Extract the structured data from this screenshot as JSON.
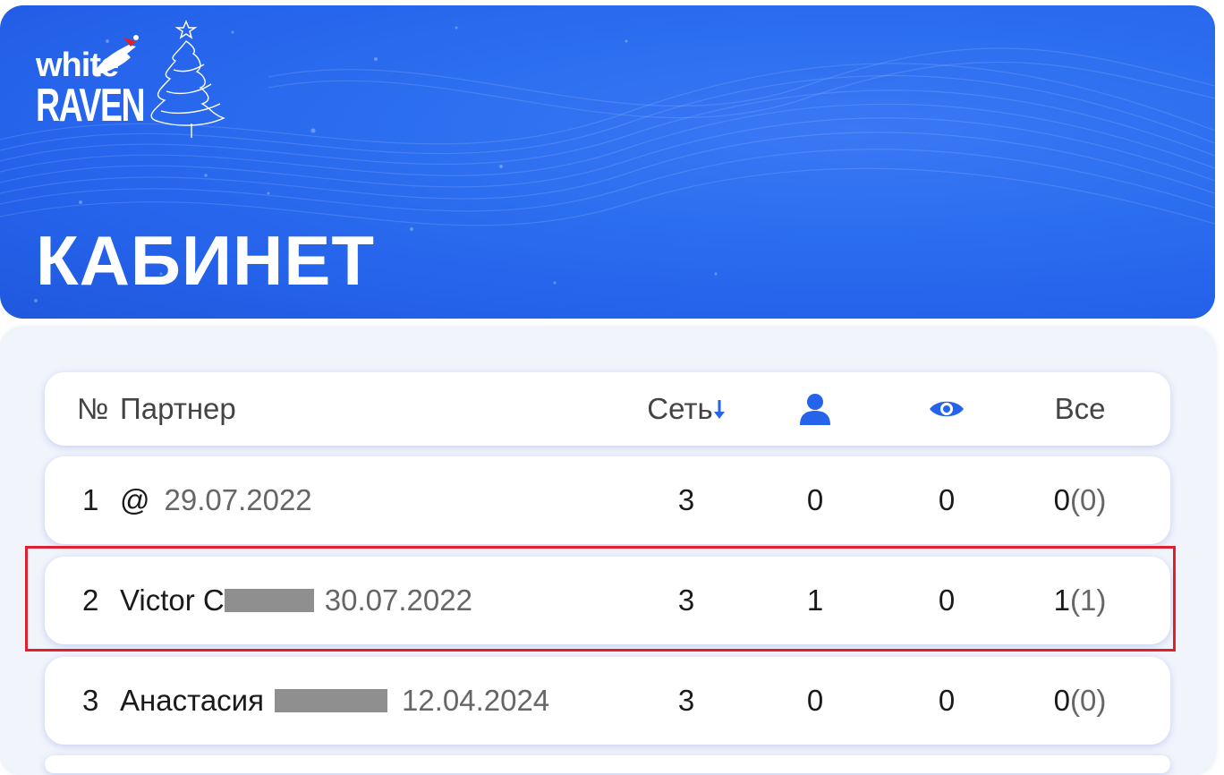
{
  "brand": {
    "line1": "white",
    "line2": "RAVEN"
  },
  "page": {
    "title": "КАБИНЕТ"
  },
  "table": {
    "headers": {
      "number": "№",
      "partner": "Партнер",
      "network": "Сеть",
      "all": "Все"
    },
    "icons": {
      "sort": "arrow-down-icon",
      "users": "user-icon",
      "views": "eye-icon"
    },
    "rows": [
      {
        "num": "1",
        "name": "@",
        "date": "29.07.2022",
        "network": "3",
        "users": "0",
        "views": "0",
        "all": "0",
        "all_paren": "(0)"
      },
      {
        "num": "2",
        "name": "Victor C",
        "date": "30.07.2022",
        "network": "3",
        "users": "1",
        "views": "0",
        "all": "1",
        "all_paren": "(1)"
      },
      {
        "num": "3",
        "name": "Анастасия",
        "date": "12.04.2024",
        "network": "3",
        "users": "0",
        "views": "0",
        "all": "0",
        "all_paren": "(0)"
      }
    ]
  },
  "colors": {
    "brand_blue": "#2563eb",
    "highlight_red": "#e0202c"
  }
}
